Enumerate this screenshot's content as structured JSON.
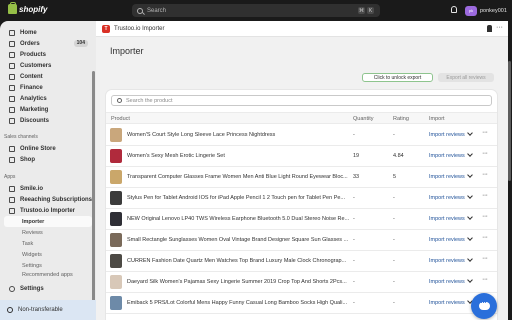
{
  "topbar": {
    "brand": "shopify",
    "search_placeholder": "Search",
    "shortcut_keys": [
      "⌘",
      "K"
    ],
    "store_initials": "pk",
    "store_name": "ponkey001"
  },
  "sidebar": {
    "items": [
      {
        "label": "Home",
        "icon": "home-icon"
      },
      {
        "label": "Orders",
        "icon": "orders-icon",
        "count": "104"
      },
      {
        "label": "Products",
        "icon": "products-icon"
      },
      {
        "label": "Customers",
        "icon": "customers-icon"
      },
      {
        "label": "Content",
        "icon": "content-icon"
      },
      {
        "label": "Finance",
        "icon": "finance-icon"
      },
      {
        "label": "Analytics",
        "icon": "analytics-icon"
      },
      {
        "label": "Marketing",
        "icon": "marketing-icon"
      },
      {
        "label": "Discounts",
        "icon": "discounts-icon"
      }
    ],
    "sales_channels_label": "Sales channels",
    "sales_channels": [
      {
        "label": "Online Store",
        "icon": "online-store-icon"
      },
      {
        "label": "Shop",
        "icon": "shop-icon"
      }
    ],
    "apps_label": "Apps",
    "apps": [
      {
        "label": "Smile.io",
        "icon": "smile-io-icon"
      },
      {
        "label": "Reeaching Subscriptions",
        "icon": "subscriptions-icon"
      },
      {
        "label": "Trustoo.io Importer",
        "icon": "trustoo-icon"
      }
    ],
    "app_subitems": [
      "Importer",
      "Reviews",
      "Task",
      "Widgets",
      "Settings",
      "Recommended apps"
    ],
    "settings_label": "Settings",
    "non_transferable_label": "Non-transferable"
  },
  "appbar": {
    "logo_letter": "T",
    "title": "Trustoo.io Importer",
    "more": "···"
  },
  "page": {
    "title": "Importer",
    "unlock_export": "Click to unlock export",
    "export_all": "Export all reviews",
    "table_search_placeholder": "Search the product"
  },
  "table": {
    "headers": {
      "product": "Product",
      "quantity": "Quantity",
      "rating": "Rating",
      "import": "Import"
    },
    "rows": [
      {
        "name": "Women'S Court Style Long Sleeve Lace Princess Nightdress",
        "qty": "-",
        "rating": "-",
        "action": "Import reviews",
        "thumb": "#c9a77c"
      },
      {
        "name": "Women's Sexy Mesh Erotic Lingerie Set",
        "qty": "19",
        "rating": "4.84",
        "action": "Import reviews",
        "thumb": "#b02a3c"
      },
      {
        "name": "Transparent Computer Glasses Frame Women Men Anti Blue Light Round Eyewear Bloc...",
        "qty": "33",
        "rating": "5",
        "action": "Import reviews",
        "thumb": "#caa76a"
      },
      {
        "name": "Stylus Pen for Tablet Android IOS for iPad Apple Pencil 1 2 Touch pen for Tablet Pen Pe...",
        "qty": "-",
        "rating": "-",
        "action": "Import reviews",
        "thumb": "#3c3c3c"
      },
      {
        "name": "NEW Original Lenovo LP40 TWS Wireless Earphone Bluetooth 5.0 Dual Stereo Noise Re...",
        "qty": "-",
        "rating": "-",
        "action": "Import reviews",
        "thumb": "#2f2f36"
      },
      {
        "name": "Small Rectangle Sunglasses Women Oval Vintage Brand Designer Square Sun Glasses ...",
        "qty": "-",
        "rating": "-",
        "action": "Import reviews",
        "thumb": "#7a6a5a"
      },
      {
        "name": "CURREN Fashion Date Quartz Men Watches Top Brand Luxury Male Clock Chronograp...",
        "qty": "-",
        "rating": "-",
        "action": "Import reviews",
        "thumb": "#4d4a45"
      },
      {
        "name": "Daeyard Silk Women's Pajamas Sexy Lingerie Summer 2019 Crop Top And Shorts 2Pcs...",
        "qty": "-",
        "rating": "-",
        "action": "Import reviews",
        "thumb": "#d8c8b8"
      },
      {
        "name": "Emiback 5 PRS/Lot Colorful Mens Happy Funny Casual Long Bamboo Socks High Quali...",
        "qty": "-",
        "rating": "-",
        "action": "Import reviews",
        "thumb": "#6d8aa8"
      }
    ]
  },
  "colors": {
    "accent": "#1f5199",
    "brand": "#95bf47",
    "chat": "#2a6fdb"
  }
}
